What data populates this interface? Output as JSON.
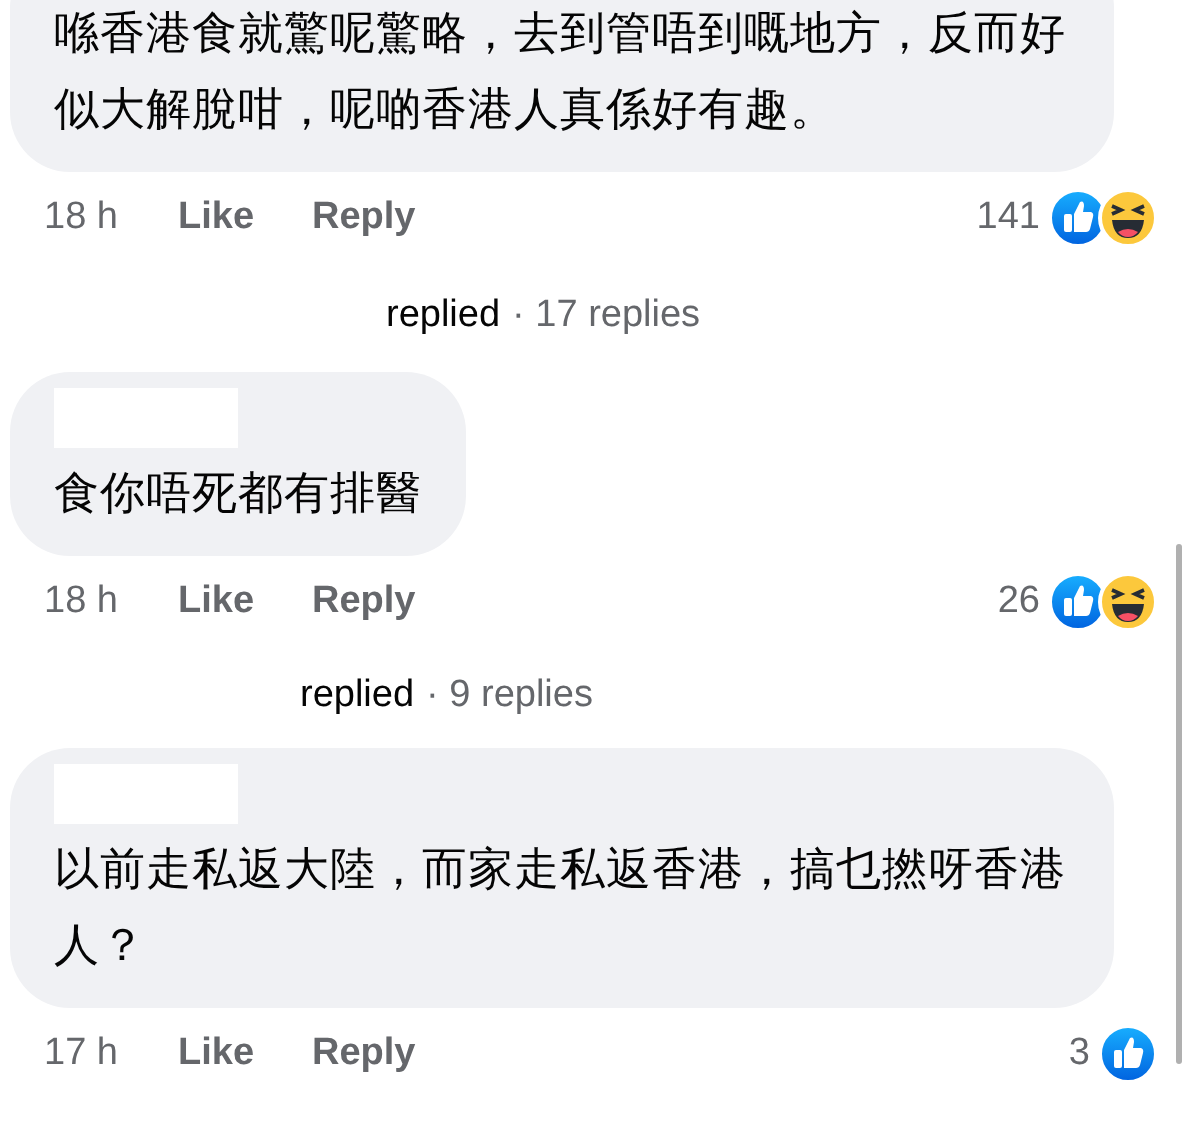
{
  "comments": [
    {
      "name_redacted": false,
      "text": "喺香港食就驚呢驚略，去到管唔到嘅地方，反而好似大解脫咁，呢啲香港人真係好有趣。",
      "time": "18 h",
      "like": "Like",
      "reply": "Reply",
      "reaction_count": "141",
      "reactions": [
        {
          "kind": "like"
        },
        {
          "kind": "haha"
        }
      ],
      "replies": {
        "label": "replied",
        "count": "· 17 replies"
      }
    },
    {
      "name_redacted": true,
      "text": "食你唔死都有排醫",
      "time": "18 h",
      "like": "Like",
      "reply": "Reply",
      "reaction_count": "26",
      "reactions": [
        {
          "kind": "like"
        },
        {
          "kind": "haha"
        }
      ],
      "replies": {
        "label": "replied",
        "count": "· 9 replies"
      }
    },
    {
      "name_redacted": true,
      "text": "以前走私返大陸，而家走私返香港，搞乜撚呀香港人？",
      "time": "17 h",
      "like": "Like",
      "reply": "Reply",
      "reaction_count": "3",
      "reactions": [
        {
          "kind": "like"
        }
      ]
    }
  ]
}
